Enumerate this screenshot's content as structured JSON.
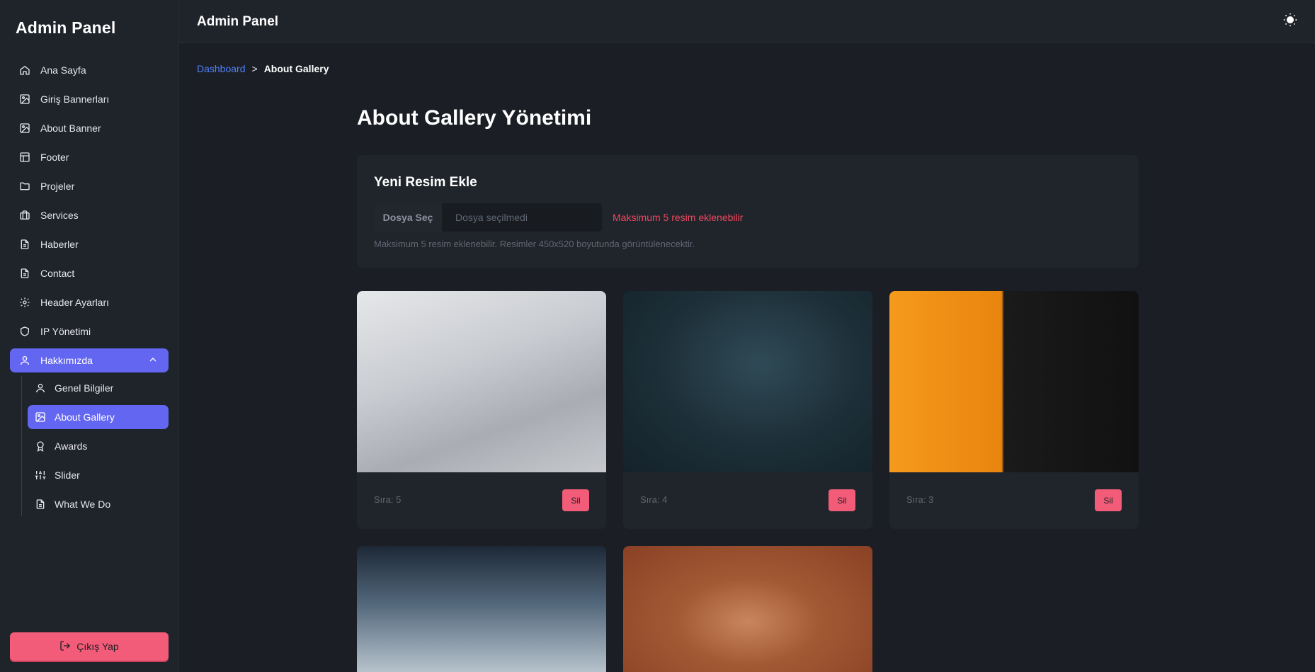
{
  "sidebar": {
    "brand": "Admin Panel",
    "items": [
      {
        "label": "Ana Sayfa",
        "icon": "home-icon"
      },
      {
        "label": "Giriş Bannerları",
        "icon": "image-icon"
      },
      {
        "label": "About Banner",
        "icon": "image-icon"
      },
      {
        "label": "Footer",
        "icon": "layout-icon"
      },
      {
        "label": "Projeler",
        "icon": "folder-icon"
      },
      {
        "label": "Services",
        "icon": "briefcase-icon"
      },
      {
        "label": "Haberler",
        "icon": "file-text-icon"
      },
      {
        "label": "Contact",
        "icon": "file-text-icon"
      },
      {
        "label": "Header Ayarları",
        "icon": "gear-icon"
      },
      {
        "label": "IP Yönetimi",
        "icon": "shield-icon"
      },
      {
        "label": "Hakkımızda",
        "icon": "user-icon"
      }
    ],
    "subitems": [
      {
        "label": "Genel Bilgiler",
        "icon": "user-icon"
      },
      {
        "label": "About Gallery",
        "icon": "image-icon"
      },
      {
        "label": "Awards",
        "icon": "award-icon"
      },
      {
        "label": "Slider",
        "icon": "sliders-icon"
      },
      {
        "label": "What We Do",
        "icon": "file-text-icon"
      }
    ],
    "logout": "Çıkış Yap"
  },
  "topbar": {
    "title": "Admin Panel"
  },
  "breadcrumb": {
    "link": "Dashboard",
    "sep": ">",
    "current": "About Gallery"
  },
  "main": {
    "title": "About Gallery Yönetimi",
    "upload": {
      "title": "Yeni Resim Ekle",
      "choose_label": "Dosya Seç",
      "no_file": "Dosya seçilmedi",
      "limit_msg": "Maksimum 5 resim eklenebilir",
      "hint": "Maksimum 5 resim eklenebilir. Resimler 450x520 boyutunda görüntülenecektir."
    },
    "gallery": [
      {
        "order": "Sıra: 5",
        "delete": "Sil"
      },
      {
        "order": "Sıra: 4",
        "delete": "Sil"
      },
      {
        "order": "Sıra: 3",
        "delete": "Sil"
      },
      {
        "order": "",
        "delete": ""
      },
      {
        "order": "",
        "delete": ""
      }
    ]
  },
  "colors": {
    "accent": "#6366f1",
    "danger": "#f25c78",
    "link": "#4f7ff7"
  }
}
